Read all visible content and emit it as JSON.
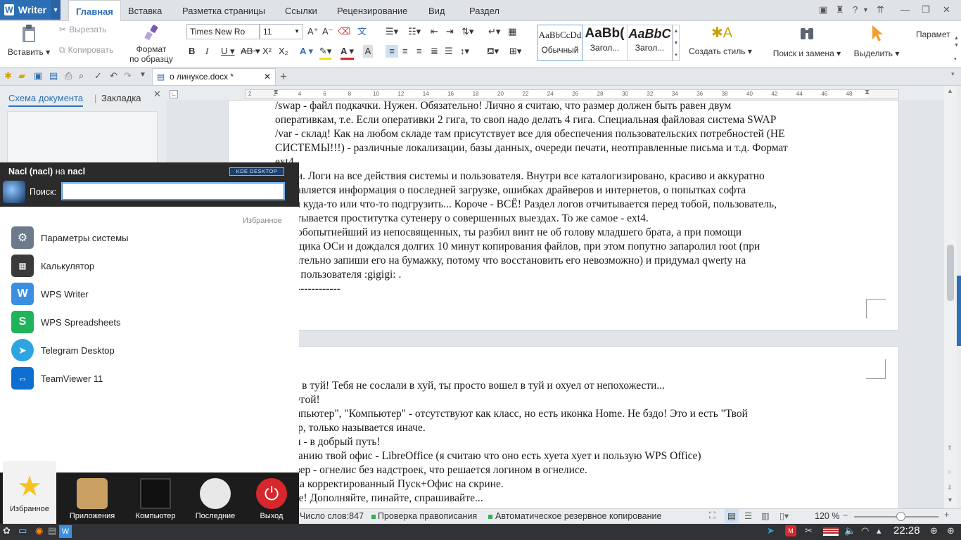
{
  "app": {
    "name": "Writer"
  },
  "menu": {
    "tabs": [
      "Главная",
      "Вставка",
      "Разметка страницы",
      "Ссылки",
      "Рецензирование",
      "Вид",
      "Раздел"
    ],
    "active": "Главная"
  },
  "ribbon": {
    "paste": "Вставить",
    "cut": "Вырезать",
    "copy": "Копировать",
    "format_painter_1": "Формат",
    "format_painter_2": "по образцу",
    "font_name": "Times New Ro",
    "font_size": "11",
    "styles": [
      {
        "preview": "AaBbCcDd",
        "label": "Обычный"
      },
      {
        "preview": "AaBb(",
        "label": "Загол..."
      },
      {
        "preview": "AaBbC",
        "label": "Загол..."
      }
    ],
    "new_style": "Создать стиль",
    "find_replace": "Поиск и замена",
    "select": "Выделить",
    "params": "Парамет"
  },
  "document_tab": {
    "title": "о линуксе.docx *"
  },
  "left_pane": {
    "tab1": "Схема документа",
    "tab2": "Закладка"
  },
  "ruler_marks": [
    "2",
    "2",
    "4",
    "6",
    "8",
    "10",
    "12",
    "14",
    "16",
    "18",
    "20",
    "22",
    "24",
    "26",
    "28",
    "30",
    "32",
    "34",
    "36",
    "38",
    "40",
    "42",
    "44",
    "46",
    "48"
  ],
  "page1_lines": [
    "/swap - файл подкачки. Нужен. Обязательно! Лично я считаю, что размер должен быть равен двум",
    "оперативкам, т.е. Если оперативки 2 гига, то своп надо делать 4 гига. Специальная файловая система SWAP",
    "/var - склад! Как на любом складе там присутствует все для обеспечения пользовательских потребностей (НЕ",
    "СИСТЕМЫ!!!) - различные локализации, базы данных, очереди печати, неотправленные письма и т.д. Формат",
    "ext4",
    "- логи. Логи на все действия системы и пользователя. Внутри все каталогизировано, красиво и аккуратно",
    "доставляется информация о последней загрузке, ошибках драйверов и интернетов, о попытках софта",
    "лезти куда-то или что-то подгрузить... Короче - ВСЁ! Раздел логов отчитывается перед тобой, пользователь,",
    "отчитывается проститутка сутенеру о совершенных выездах. То же самое - ext4.",
    ", о любопытнейший из непосвященных, ты разбил винт не об голову младшего брата, а при помощи",
    "ановщика ОСи и дождался долгих 10 минут копирования файлов, при этом попутно запаролил root (при",
    "обязательно запиши его на бумажку, потому что восстановить его невозможно) и придумал qwerty на",
    "щего пользователя :gigigi: .",
    "------------------"
  ],
  "page2_lines": [
    "ошел в туй! Тебя не сослали в хуй, ты просто вошел в туй и охуел от непохожести...",
    ":- другой!",
    "й компьютер\", \"Компьютер\" - отсутствуют как класс, но есть иконка Home. Не бздо! Это и есть \"Твой",
    "ьютер, только называется иначе.",
    "ак бы - в добрый путь!",
    "молчанию твой офис - LibreOffice (я считаю что оно есть хуета хует и пользую WPS Office)",
    "браузер - огнелис без надстроек, что решается логином в огнелисе.",
    "слегка корректированный Пуск+Офис на скрине.",
    "ня все! Дополняйте, пинайте, спрашивайте..."
  ],
  "statusbar": {
    "word_count": "Число слов:847",
    "spellcheck": "Проверка правописания",
    "autosave": "Автоматическое резервное копирование",
    "zoom": "120 %"
  },
  "kde_menu": {
    "user_name": "Nacl (nacl)",
    "on": "на",
    "host": "nacl",
    "badge": "KDE DESKTOP",
    "search_label": "Поиск:",
    "search_value": "",
    "section": "Избранное",
    "favorites": [
      {
        "label": "Параметры системы",
        "icon": "system-settings-icon",
        "color": "#6b7b8c"
      },
      {
        "label": "Калькулятор",
        "icon": "calculator-icon",
        "color": "#3a3a3a"
      },
      {
        "label": "WPS Writer",
        "icon": "wps-writer-icon",
        "color": "#3b8fe0"
      },
      {
        "label": "WPS Spreadsheets",
        "icon": "wps-spreadsheets-icon",
        "color": "#1fb45a"
      },
      {
        "label": "Telegram Desktop",
        "icon": "telegram-icon",
        "color": "#2ca5e0"
      },
      {
        "label": "TeamViewer 11",
        "icon": "teamviewer-icon",
        "color": "#0e6fd1"
      }
    ],
    "tabs": [
      {
        "label": "Избранное",
        "icon": "star-icon"
      },
      {
        "label": "Приложения",
        "icon": "applications-icon"
      },
      {
        "label": "Компьютер",
        "icon": "computer-icon"
      },
      {
        "label": "Последние",
        "icon": "recent-clock-icon"
      },
      {
        "label": "Выход",
        "icon": "power-icon"
      }
    ]
  },
  "taskbar": {
    "time": "22:28"
  }
}
